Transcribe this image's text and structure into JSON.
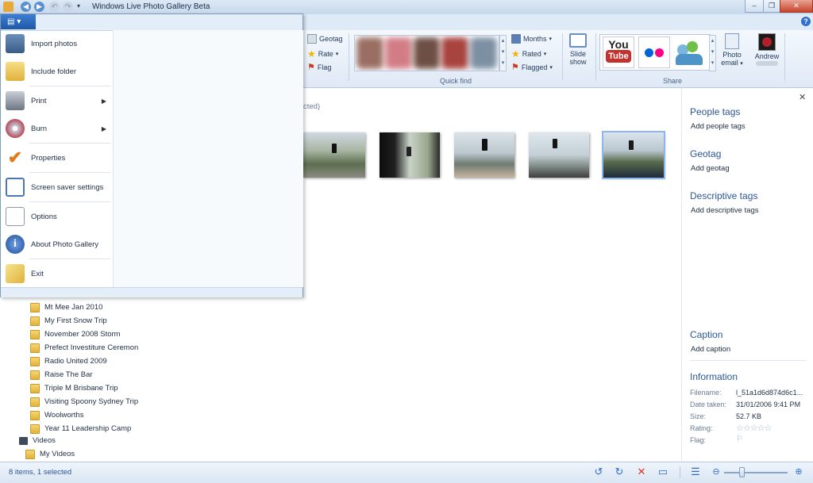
{
  "window": {
    "title": "Windows Live Photo Gallery Beta"
  },
  "ribbon": {
    "geotag": "Geotag",
    "rate": "Rate",
    "flag": "Flag",
    "months": "Months",
    "rated": "Rated",
    "flagged": "Flagged",
    "quick_find": "Quick find",
    "slide_show_1": "Slide",
    "slide_show_2": "show",
    "share": "Share",
    "youtube_1": "You",
    "youtube_2": "Tube",
    "photo_email_1": "Photo",
    "photo_email_2": "email",
    "user": "Andrew"
  },
  "file_menu": {
    "items": [
      {
        "label": "Import photos",
        "icon": "camera-import-icon"
      },
      {
        "label": "Include folder",
        "icon": "folder-include-icon"
      },
      {
        "label": "Print",
        "icon": "printer-icon",
        "submenu": true
      },
      {
        "label": "Burn",
        "icon": "disc-burn-icon",
        "submenu": true
      },
      {
        "label": "Properties",
        "icon": "checkmark-icon"
      },
      {
        "label": "Screen saver settings",
        "icon": "screensaver-icon"
      },
      {
        "label": "Options",
        "icon": "options-icon"
      },
      {
        "label": "About Photo Gallery",
        "icon": "info-icon"
      },
      {
        "label": "Exit",
        "icon": "exit-icon"
      }
    ]
  },
  "main": {
    "selection_fragment": "cted)"
  },
  "tree": {
    "folders": [
      "Mt Mee Jan 2010",
      "My First Snow Trip",
      "November 2008 Storm",
      "Prefect Investiture Ceremon",
      "Radio United 2009",
      "Raise The Bar",
      "Triple M Brisbane Trip",
      "Visiting Spoony Sydney Trip",
      "Woolworths",
      "Year 11 Leadership Camp"
    ],
    "videos": "Videos",
    "my_videos": "My Videos"
  },
  "info_pane": {
    "people_tags": "People tags",
    "add_people_tags": "Add people tags",
    "geotag": "Geotag",
    "add_geotag": "Add geotag",
    "descriptive_tags": "Descriptive tags",
    "add_descriptive_tags": "Add descriptive tags",
    "caption": "Caption",
    "add_caption": "Add caption",
    "information": "Information",
    "filename_label": "Filename:",
    "filename_value": "l_51a1d6d874d6c1...",
    "date_label": "Date taken:",
    "date_value": "31/01/2006  9:41 PM",
    "size_label": "Size:",
    "size_value": "52.7 KB",
    "rating_label": "Rating:",
    "rating_value": 0,
    "flag_label": "Flag:"
  },
  "status": {
    "text": "8 items, 1 selected"
  },
  "colors": {
    "accent": "#2b5797",
    "menu_tab": "#1f58a8"
  }
}
